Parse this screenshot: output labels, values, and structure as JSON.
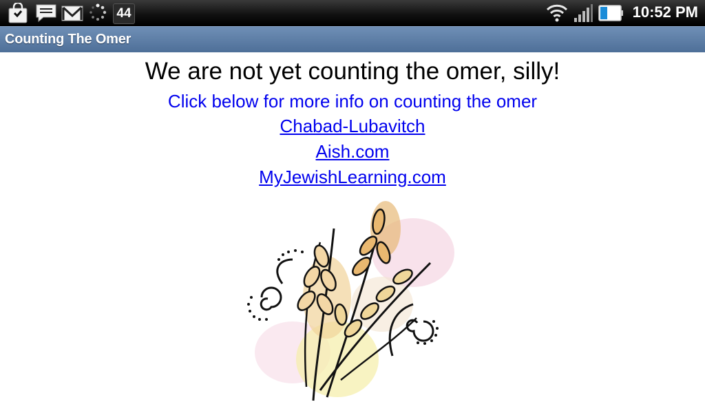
{
  "status_bar": {
    "time": "10:52 PM",
    "notification_count": "44",
    "icons": [
      "shopping-bag-icon",
      "chat-icon",
      "gmail-icon",
      "sync-icon",
      "wifi-icon",
      "signal-icon",
      "battery-icon"
    ]
  },
  "app": {
    "title": "Counting The Omer"
  },
  "content": {
    "headline": "We are not yet counting the omer, silly!",
    "subline": "Click below for more info on counting the omer",
    "links": [
      "Chabad-Lubavitch",
      "Aish.com",
      "MyJewishLearning.com"
    ],
    "image_icon": "wheat-illustration-icon"
  },
  "colors": {
    "titlebar": "#5f80a8",
    "link": "#0000ee"
  }
}
